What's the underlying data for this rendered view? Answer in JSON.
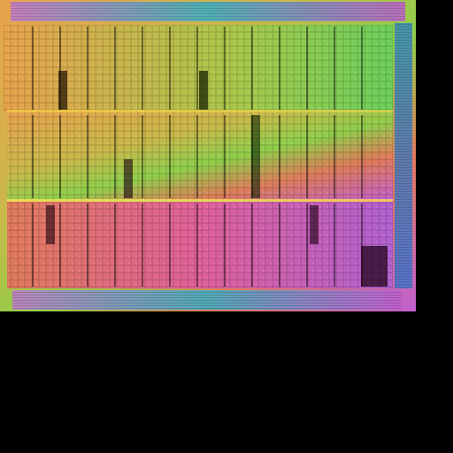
{
  "image": {
    "subject": "silicon-die-photo",
    "background": "#000000",
    "palette": [
      "#e8a24c",
      "#c9b84a",
      "#8fcf4a",
      "#e07a5a",
      "#e0609a",
      "#c060d0",
      "#3ab0c8"
    ]
  }
}
